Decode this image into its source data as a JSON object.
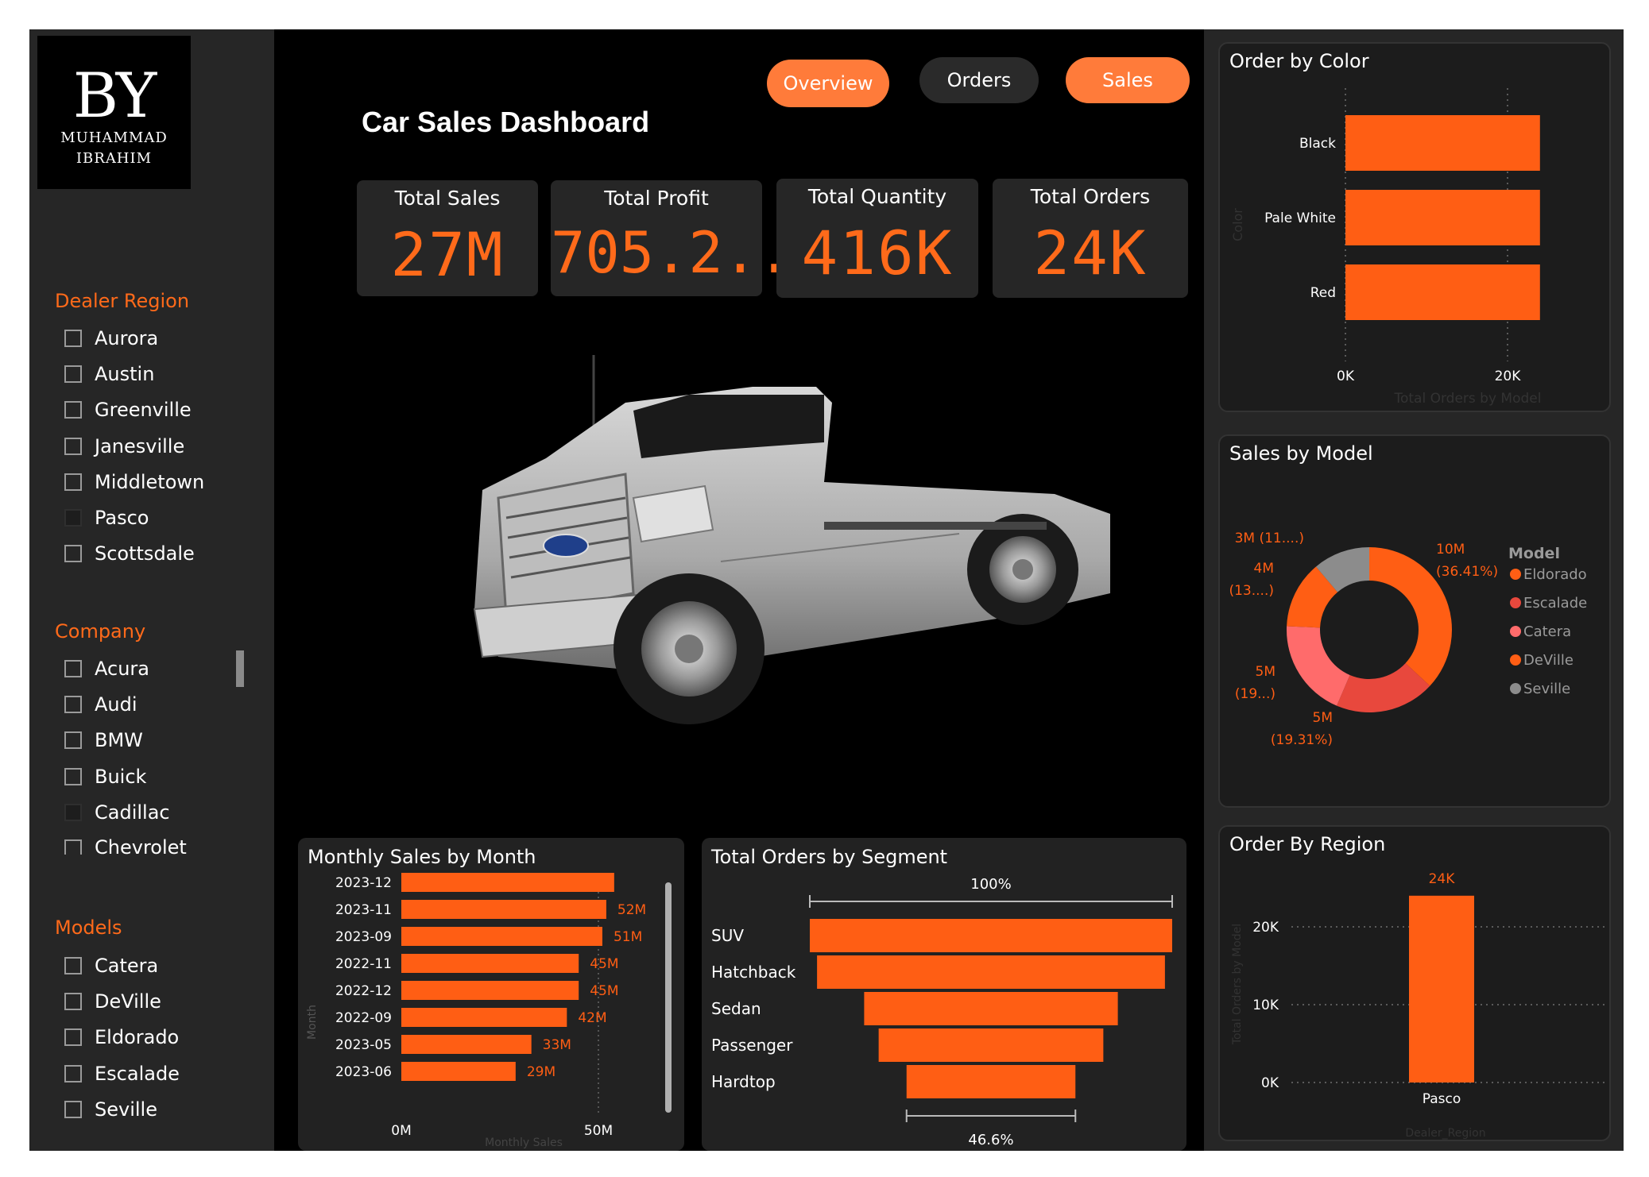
{
  "logo": {
    "monogram": "BY",
    "name_line1": "MUHAMMAD",
    "name_line2": "IBRAHIM"
  },
  "header": {
    "title": "Car Sales Dashboard"
  },
  "nav": {
    "overview": "Overview",
    "orders": "Orders",
    "sales": "Sales"
  },
  "kpis": [
    {
      "label": "Total Sales",
      "value": "27M"
    },
    {
      "label": "Total Profit",
      "value": "705.2..."
    },
    {
      "label": "Total Quantity",
      "value": "416K"
    },
    {
      "label": "Total Orders",
      "value": "24K"
    }
  ],
  "slicers": {
    "dealer_region": {
      "title": "Dealer Region",
      "items": [
        "Aurora",
        "Austin",
        "Greenville",
        "Janesville",
        "Middletown",
        "Pasco",
        "Scottsdale"
      ],
      "selected": "Pasco"
    },
    "company": {
      "title": "Company",
      "items": [
        "Acura",
        "Audi",
        "BMW",
        "Buick",
        "Cadillac",
        "Chevrolet"
      ],
      "selected": "Cadillac"
    },
    "models": {
      "title": "Models",
      "items": [
        "Catera",
        "DeVille",
        "Eldorado",
        "Escalade",
        "Seville"
      ]
    }
  },
  "colors": {
    "accent": "#ff5e14",
    "accent_light": "#ff7b3a",
    "panel": "#222222",
    "sidebar": "#262626"
  },
  "chart_data": [
    {
      "id": "monthly_sales",
      "type": "bar",
      "orientation": "horizontal",
      "title": "Monthly Sales by Month",
      "xlabel": "Monthly Sales",
      "ylabel": "Month",
      "categories": [
        "2023-12",
        "2023-11",
        "2023-09",
        "2022-11",
        "2022-12",
        "2022-09",
        "2023-05",
        "2023-06"
      ],
      "values": [
        54,
        52,
        51,
        45,
        45,
        42,
        33,
        29
      ],
      "data_labels": [
        "",
        "52M",
        "51M",
        "45M",
        "45M",
        "42M",
        "33M",
        "29M"
      ],
      "xticks": [
        "0M",
        "50M"
      ],
      "xlim": [
        0,
        50
      ]
    },
    {
      "id": "orders_by_segment",
      "type": "funnel",
      "title": "Total Orders by Segment",
      "categories": [
        "SUV",
        "Hatchback",
        "Sedan",
        "Passenger",
        "Hardtop"
      ],
      "values": [
        100,
        96,
        70,
        62,
        46.6
      ],
      "top_label": "100%",
      "bottom_label": "46.6%"
    },
    {
      "id": "order_by_color",
      "type": "bar",
      "orientation": "horizontal",
      "title": "Order by Color",
      "ylabel": "Color",
      "xlabel": "Total Orders by Model",
      "categories": [
        "Black",
        "Pale White",
        "Red"
      ],
      "values": [
        24,
        24,
        24
      ],
      "xticks": [
        "0K",
        "20K"
      ],
      "xlim": [
        0,
        20
      ]
    },
    {
      "id": "sales_by_model",
      "type": "pie",
      "donut": true,
      "title": "Sales by Model",
      "legend_title": "Model",
      "labels": [
        "Eldorado",
        "Escalade",
        "Catera",
        "DeVille",
        "Seville"
      ],
      "values": [
        36.41,
        19.31,
        19,
        13,
        11
      ],
      "data_labels": [
        [
          "10M",
          "(36.41%)"
        ],
        [
          "5M",
          "(19.31%)"
        ],
        [
          "5M",
          "(19...)"
        ],
        [
          "4M",
          "(13....)"
        ],
        [
          "3M (11....)"
        ]
      ],
      "colors": [
        "#ff5e14",
        "#e8483d",
        "#ff6b6b",
        "#ff5e14",
        "#8c8c8c"
      ],
      "legend_colors": [
        "#ff5e14",
        "#e8483d",
        "#ff6b6b",
        "#ff5e14",
        "#8c8c8c"
      ]
    },
    {
      "id": "order_by_region",
      "type": "bar",
      "title": "Order By Region",
      "xlabel": "Dealer_Region",
      "ylabel": "Total Orders by Model",
      "categories": [
        "Pasco"
      ],
      "values": [
        24
      ],
      "data_labels": [
        "24K"
      ],
      "yticks": [
        "0K",
        "10K",
        "20K"
      ],
      "ylim": [
        0,
        24
      ]
    }
  ]
}
